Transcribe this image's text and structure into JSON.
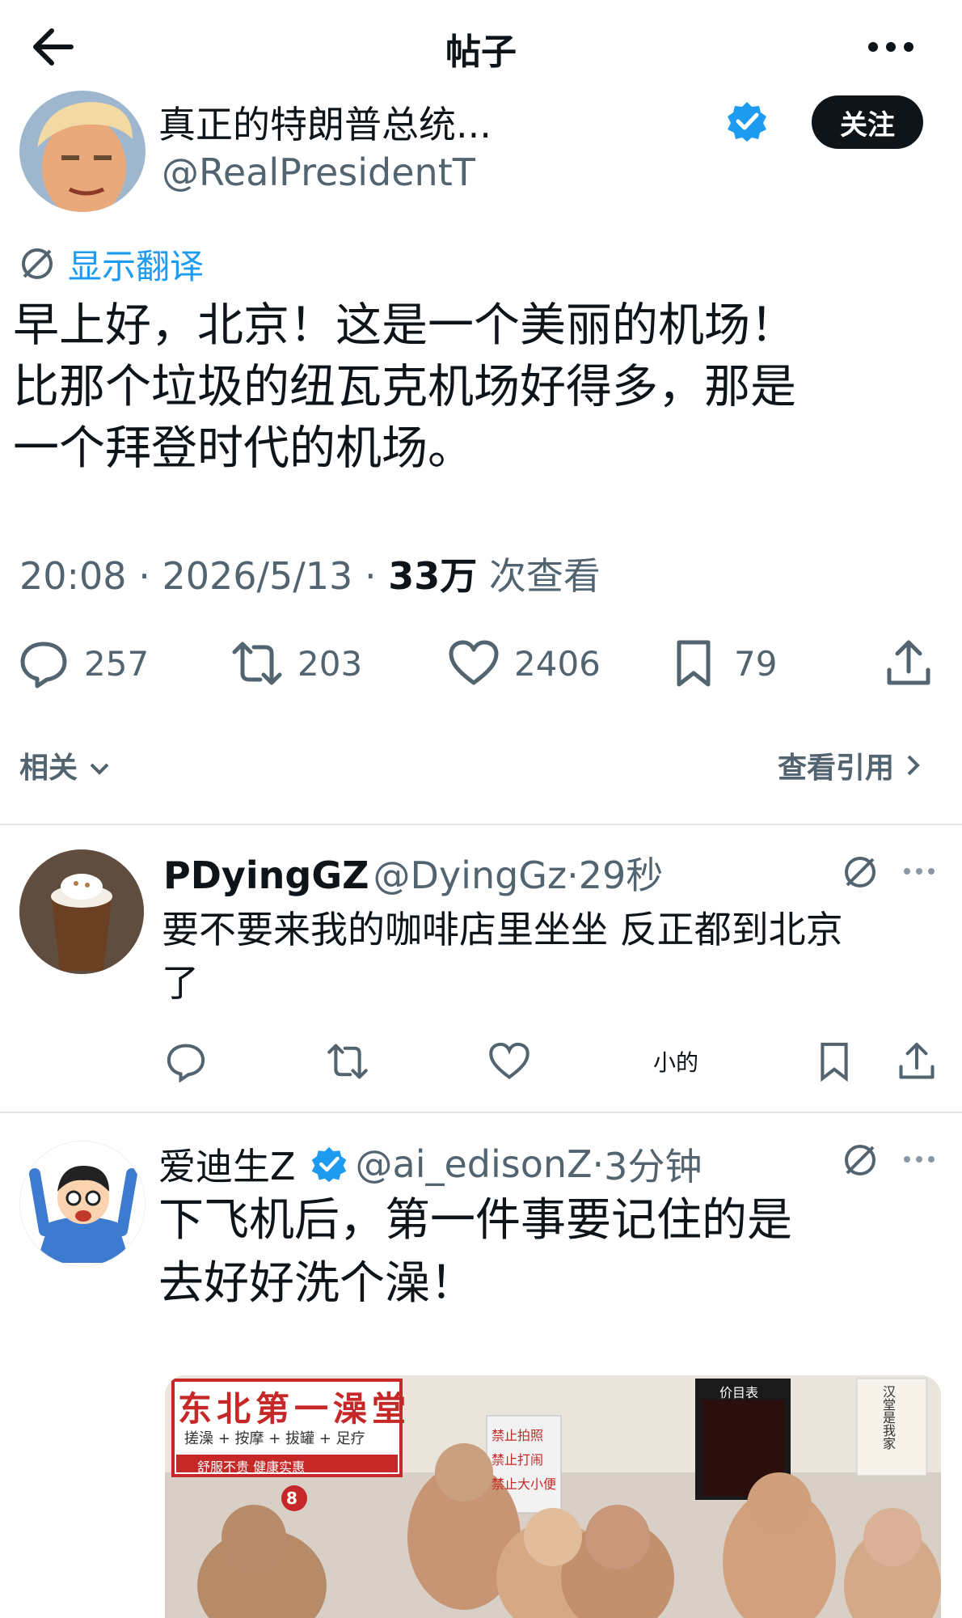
{
  "header": {
    "title": "帖子"
  },
  "post": {
    "author_name": "真正的特朗普总统...",
    "author_handle": "@RealPresidentT",
    "follow_label": "关注",
    "translate_label": "显示翻译",
    "text_lines": [
      "早上好，北京！这是一个美丽的机场！",
      "比那个垃圾的纽瓦克机场好得多，那是",
      "一个拜登时代的机场。"
    ],
    "time": "20:08",
    "date": "2026/5/13",
    "views_count": "33万",
    "views_label": "次查看",
    "stats": {
      "replies": "257",
      "retweets": "203",
      "likes": "2406",
      "bookmarks": "79"
    },
    "related_label": "相关",
    "view_quotes_label": "查看引用"
  },
  "replies": [
    {
      "name": "PDyingGZ",
      "handle": "@DyingGz",
      "time": "29秒",
      "text_lines": [
        "要不要来我的咖啡店里坐坐 反正都到北京",
        "了"
      ],
      "action_extra": "小的"
    },
    {
      "name": "爱迪生Z",
      "handle": "@ai_edisonZ",
      "time": "3分钟",
      "text_lines": [
        "下飞机后，第一件事要记住的是",
        "去好好洗个澡！"
      ],
      "image": {
        "sign_title": "东北第一澡堂",
        "sign_services": "搓澡 + 按摩 + 拔罐 + 足疗",
        "sign_slogan": "舒服不贵  健康实惠",
        "notice_lines": [
          "禁止拍照",
          "禁止打闹",
          "禁止大小便"
        ],
        "price_board_title": "价目表",
        "right_sign": "汉堂是我家",
        "door_number": "8"
      }
    }
  ],
  "colors": {
    "accent": "#1d9bf0",
    "text": "#0f1419",
    "secondary": "#536471"
  }
}
